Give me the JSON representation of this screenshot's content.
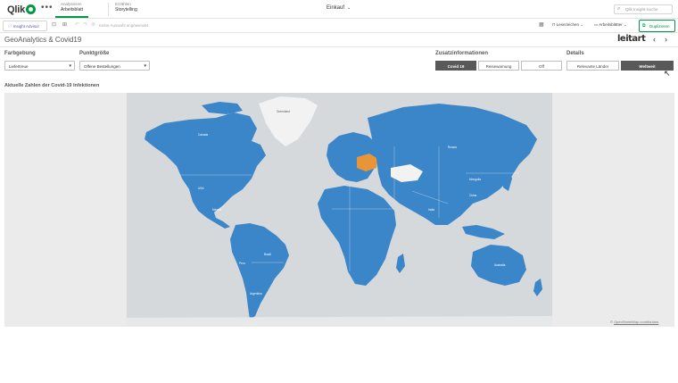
{
  "topnav": {
    "logo_text": "Qlik",
    "tabs": [
      {
        "small": "Analysieren",
        "label": "Arbeitsblatt",
        "active": true
      },
      {
        "small": "Erzählen",
        "label": "Storytelling",
        "active": false
      }
    ],
    "app_title": "Einkauf",
    "search_placeholder": "Qlik Insight-Suche"
  },
  "toolbar": {
    "insight_advisor": "Insight Advisor",
    "selection_text": "Keine Auswahl angewendet",
    "bookmarks": "Lesezeichen",
    "sheets": "Arbeitsblätter",
    "duplicate": "Duplizieren"
  },
  "sheet": {
    "title": "GeoAnalytics & Covid19",
    "brand": "leitart"
  },
  "filters": {
    "farbgebung": {
      "label": "Farbgebung",
      "value": "Liefertreue"
    },
    "punktgroesse": {
      "label": "Punktgröße",
      "value": "Offene Bestellungen"
    },
    "zusatz": {
      "label": "Zusatzinformationen",
      "options": [
        "Covid 19",
        "Reisewarnung",
        "Off"
      ],
      "selected": "Covid 19"
    },
    "details": {
      "label": "Details",
      "options": [
        "Relevante Länder",
        "Weltweit"
      ],
      "selected": "Weltweit"
    }
  },
  "chart": {
    "title": "Aktuelle Zahlen der Covid-19 Infektionen",
    "attribution_prefix": "© ",
    "attribution_link": "OpenStreetMap contributors",
    "colors": {
      "land": "#3a86c8",
      "highlight": "#e8953a",
      "ocean": "#d6d9dc",
      "grey_land": "#f2f2f2"
    },
    "labels": {
      "canada": "Canada",
      "usa": "USA",
      "greenland": "Greenland",
      "russia": "Russia",
      "mongolia": "Mongolia",
      "china": "China",
      "india": "India",
      "brazil": "Brazil",
      "australia": "Australia",
      "mexico": "Mexico",
      "peru": "Peru",
      "argentina": "Argentina"
    }
  }
}
